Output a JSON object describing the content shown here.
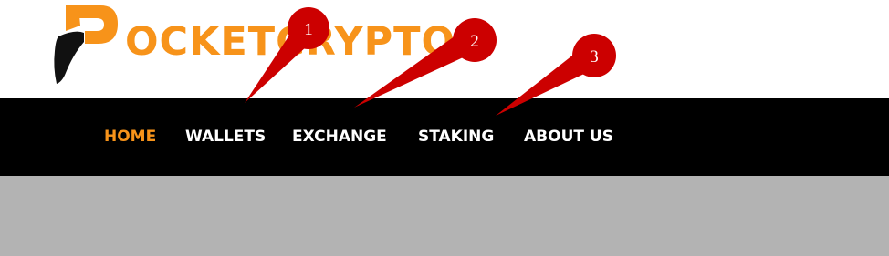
{
  "brand": {
    "logo_text": "OCKETCRYPTO",
    "accent_color": "#f7931a"
  },
  "nav": {
    "items": [
      {
        "label": "HOME",
        "active": true
      },
      {
        "label": "WALLETS",
        "active": false
      },
      {
        "label": "EXCHANGE",
        "active": false
      },
      {
        "label": "STAKING",
        "active": false
      },
      {
        "label": "ABOUT US",
        "active": false
      }
    ]
  },
  "annotations": {
    "markers": [
      "1",
      "2",
      "3"
    ],
    "color": "#cc0000"
  }
}
